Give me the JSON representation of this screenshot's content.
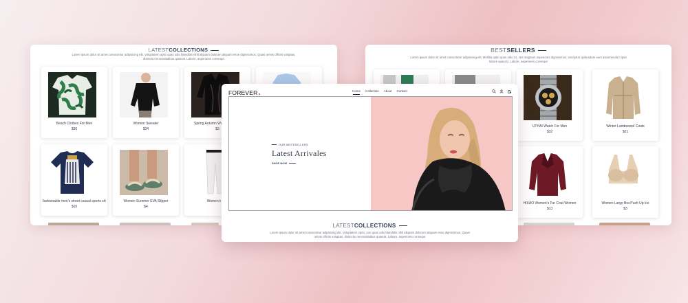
{
  "left_panel": {
    "title_light": "LATEST",
    "title_bold": "COLLECTIONS",
    "description": "Lorem ipsum dolor sit amet consectetur adipisicing elit. Voluptatem optio quas odio blanditiis nihil aliquam dolorum aliquam esse dignissimos. Quasi omnis officiis voluptas, distinctio necessitatibus quaerat. Labore, asperiores consequr",
    "products": [
      {
        "name": "Beach Clothes For Men",
        "price": "$30",
        "icon": "hawaiian-shirt"
      },
      {
        "name": "Women Sweater",
        "price": "$34",
        "icon": "black-sweater"
      },
      {
        "name": "Spring Autumn Women Blouse",
        "price": "$3",
        "icon": "satin-blouse"
      },
      {
        "name": "",
        "price": "",
        "icon": "blue-top"
      },
      {
        "name": "fashionable men's street casual sports shirt",
        "price": "$10",
        "icon": "graphic-tshirt"
      },
      {
        "name": "Women Summer EVA Slipper",
        "price": "$4",
        "icon": "slipper"
      },
      {
        "name": "Women's wi...",
        "price": "",
        "icon": "white-trousers"
      }
    ]
  },
  "right_panel": {
    "title_light": "BEST",
    "title_bold": "SELLERS",
    "description": "Lorem ipsum dolor sit amet consectetur adipisicing elit. Mollitia optio quas odio 31, nisi magnam asperiores dignissimos, excepturi quibusdam eum assumenda it ipsa labore quaerat. Labore, asperiores consequr",
    "products": [
      {
        "name": "UTHAI Watch For Men",
        "price": "$32",
        "icon": "wristwatch"
      },
      {
        "name": "Winter Lambswool Coats",
        "price": "$21",
        "icon": "trench-coat"
      },
      {
        "name": "HIXAO Women's Fur Coat Women",
        "price": "$13",
        "icon": "burgundy-coat"
      },
      {
        "name": "Women Large Bra Push Up Ice",
        "price": "$3",
        "icon": "beige-bra"
      }
    ]
  },
  "front": {
    "logo": "FOREVER",
    "nav": [
      "Home",
      "Collection",
      "About",
      "Contact"
    ],
    "nav_icons": [
      "search-icon",
      "profile-icon",
      "cart-icon"
    ],
    "hero": {
      "eyebrow": "OUR BESTSELLERS",
      "title": "Latest Arrivales",
      "cta": "SHOP NOW"
    },
    "section_title_light": "LATEST",
    "section_title_bold": "COLLECTIONS",
    "section_description": "Lorem ipsum dolor sit amet consectetur adipisicing elit. Voluptatem optio, non quas odio blanditiis nihil aliquam dolorum aliquam esse dignissimos. Quasi omnis officiis voluptas, distinctio necessitatibus quaerat. Labore, asperiores consequr"
  },
  "colors": {
    "accent": "#c93b62",
    "hero_pink": "#f7c7c6",
    "text": "#374151"
  }
}
